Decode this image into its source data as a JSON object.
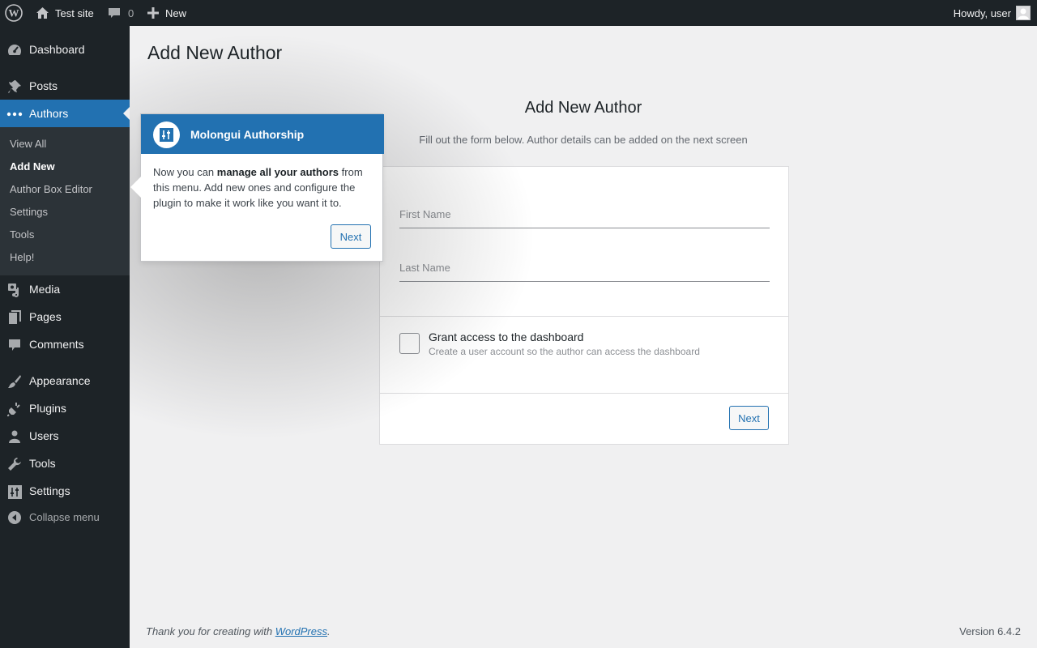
{
  "adminbar": {
    "site_name": "Test site",
    "comments_count": "0",
    "new_label": "New",
    "greeting": "Howdy, user"
  },
  "sidebar": {
    "items": [
      {
        "label": "Dashboard",
        "icon": "dashboard-icon"
      },
      {
        "label": "Posts",
        "icon": "pin-icon"
      },
      {
        "label": "Authors",
        "icon": "ellipsis-icon"
      },
      {
        "label": "Media",
        "icon": "media-icon"
      },
      {
        "label": "Pages",
        "icon": "pages-icon"
      },
      {
        "label": "Comments",
        "icon": "comment-icon"
      },
      {
        "label": "Appearance",
        "icon": "brush-icon"
      },
      {
        "label": "Plugins",
        "icon": "plugin-icon"
      },
      {
        "label": "Users",
        "icon": "user-icon"
      },
      {
        "label": "Tools",
        "icon": "wrench-icon"
      },
      {
        "label": "Settings",
        "icon": "settings-icon"
      }
    ],
    "submenu": [
      "View All",
      "Add New",
      "Author Box Editor",
      "Settings",
      "Tools",
      "Help!"
    ],
    "collapse_label": "Collapse menu"
  },
  "main": {
    "page_title": "Add New Author",
    "form_heading": "Add New Author",
    "form_subtitle": "Fill out the form below. Author details can be added on the next screen",
    "first_name_placeholder": "First Name",
    "last_name_placeholder": "Last Name",
    "checkbox_title": "Grant access to the dashboard",
    "checkbox_desc": "Create a user account so the author can access the dashboard",
    "next_label": "Next"
  },
  "pointer": {
    "title": "Molongui Authorship",
    "body_pre": "Now you can ",
    "body_bold": "manage all your authors",
    "body_post": " from this menu. Add new ones and configure the plugin to make it work like you want it to.",
    "next_label": "Next"
  },
  "footer": {
    "thanks_pre": "Thank you for creating with ",
    "thanks_link": "WordPress",
    "thanks_post": ".",
    "version": "Version 6.4.2"
  },
  "colors": {
    "accent": "#2271b1",
    "adminbar_bg": "#1d2327",
    "submenu_bg": "#2c3338",
    "page_bg": "#f0f0f1"
  }
}
